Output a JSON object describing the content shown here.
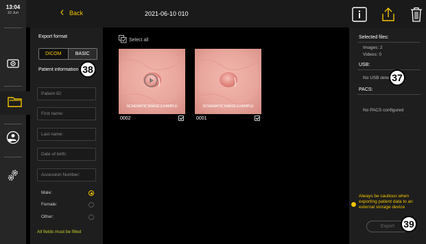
{
  "status": {
    "time": "13:04",
    "date": "10 Jun"
  },
  "header": {
    "back_label": "Back",
    "title": "2021-06-10 010"
  },
  "export_panel": {
    "format_label": "Export format",
    "formats": [
      "DICOM",
      "BASIC"
    ],
    "selected_format": "DICOM",
    "patient_info_label": "Patient information",
    "fields": [
      {
        "placeholder": "Patient ID:"
      },
      {
        "placeholder": "First name:"
      },
      {
        "placeholder": "Last name:"
      },
      {
        "placeholder": "Date of birth:"
      },
      {
        "placeholder": "Accession Number:"
      }
    ],
    "gender_options": [
      {
        "label": "Male:",
        "selected": true
      },
      {
        "label": "Female:",
        "selected": false
      },
      {
        "label": "Other:",
        "selected": false
      }
    ],
    "warning": "All fields must be filled"
  },
  "main": {
    "select_all_label": "Select all",
    "thumbnails": [
      {
        "id": "0002",
        "overlay": "SCHEMATIC IMAGE EXAMPLE",
        "checked": true,
        "is_video": true
      },
      {
        "id": "0001",
        "overlay": "SCHEMATIC IMAGE EXAMPLE",
        "checked": true,
        "is_video": false
      }
    ]
  },
  "summary": {
    "selected_files_label": "Selected files:",
    "images_label": "Images: 2",
    "videos_label": "Videos: 0",
    "usb_label": "USB:",
    "usb_status": "No USB detected",
    "pacs_label": "PACS:",
    "pacs_status": "No PACS configured",
    "caution": "Always be cautious when exporting patient data to an external storage device",
    "export_label": "Export"
  },
  "callouts": [
    "38",
    "37",
    "39"
  ],
  "colors": {
    "accent": "#f2c400",
    "panel": "#1e1e1e",
    "rail": "#262626",
    "background": "#000000"
  },
  "icons": [
    "info-icon",
    "upload-icon",
    "trash-icon",
    "monitor-icon",
    "folder-icon",
    "user-lock-icon",
    "gears-icon",
    "back-chevron-icon",
    "select-all-icon",
    "play-icon"
  ]
}
